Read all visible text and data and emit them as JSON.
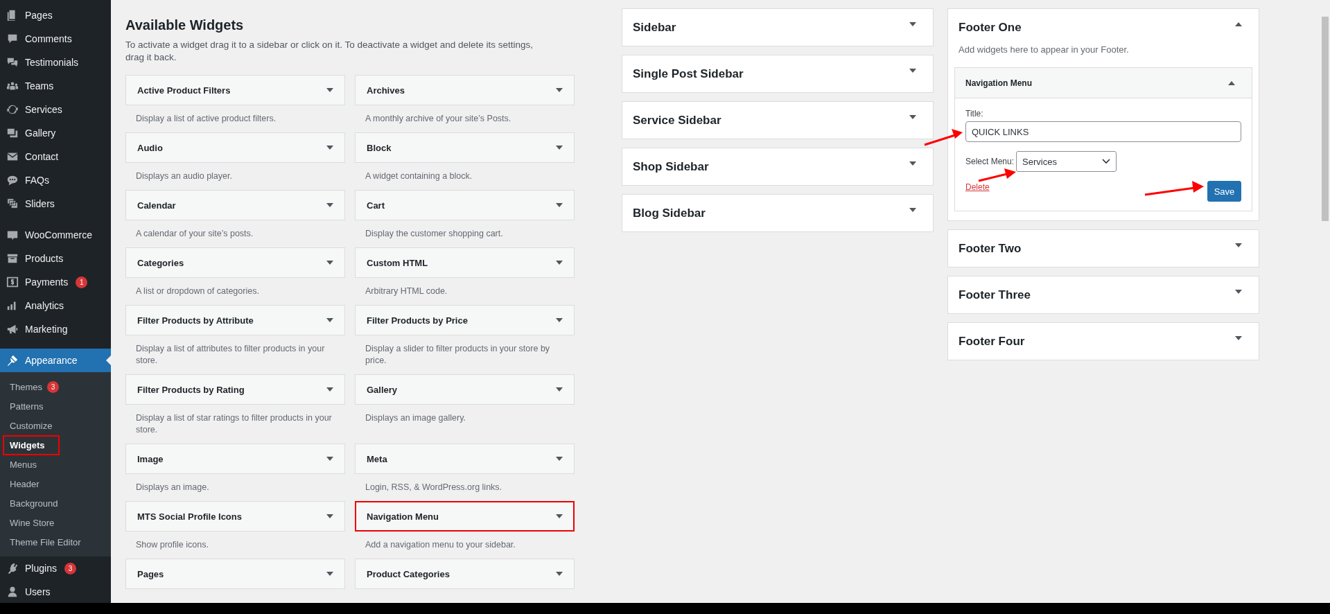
{
  "admin_menu": [
    {
      "items": [
        {
          "label": "Pages",
          "selected": false
        },
        {
          "label": "Comments",
          "selected": false
        },
        {
          "label": "Testimonials",
          "selected": false
        },
        {
          "label": "Teams",
          "selected": false
        },
        {
          "label": "Services",
          "selected": false
        },
        {
          "label": "Gallery",
          "selected": false
        },
        {
          "label": "Contact",
          "selected": false
        },
        {
          "label": "FAQs",
          "selected": false
        },
        {
          "label": "Sliders",
          "selected": false
        }
      ]
    },
    {
      "items": [
        {
          "label": "WooCommerce",
          "selected": false
        },
        {
          "label": "Products",
          "selected": false
        },
        {
          "label": "Payments",
          "selected": false,
          "badge": "1"
        },
        {
          "label": "Analytics",
          "selected": false
        },
        {
          "label": "Marketing",
          "selected": false
        }
      ]
    },
    {
      "items": [
        {
          "label": "Appearance",
          "selected": true,
          "submenu": [
            {
              "label": "Themes",
              "selected": false,
              "highlighted": false,
              "badge": "3"
            },
            {
              "label": "Patterns",
              "selected": false,
              "highlighted": false
            },
            {
              "label": "Customize",
              "selected": false,
              "highlighted": false
            },
            {
              "label": "Widgets",
              "selected": true,
              "highlighted": true
            },
            {
              "label": "Menus",
              "selected": false,
              "highlighted": false
            },
            {
              "label": "Header",
              "selected": false,
              "highlighted": false
            },
            {
              "label": "Background",
              "selected": false,
              "highlighted": false
            },
            {
              "label": "Wine Store",
              "selected": false,
              "highlighted": false
            },
            {
              "label": "Theme File Editor",
              "selected": false,
              "highlighted": false
            }
          ]
        },
        {
          "label": "Plugins",
          "selected": false,
          "badge": "3"
        },
        {
          "label": "Users",
          "selected": false
        }
      ]
    }
  ],
  "available_widgets": {
    "title": "Available Widgets",
    "description": "To activate a widget drag it to a sidebar or click on it. To deactivate a widget and delete its settings, drag it back.",
    "widgets": [
      {
        "title": "Active Product Filters",
        "description": "Display a list of active product filters.",
        "highlighted": false
      },
      {
        "title": "Archives",
        "description": "A monthly archive of your site’s Posts.",
        "highlighted": false
      },
      {
        "title": "Audio",
        "description": "Displays an audio player.",
        "highlighted": false
      },
      {
        "title": "Block",
        "description": "A widget containing a block.",
        "highlighted": false
      },
      {
        "title": "Calendar",
        "description": "A calendar of your site’s posts.",
        "highlighted": false
      },
      {
        "title": "Cart",
        "description": "Display the customer shopping cart.",
        "highlighted": false
      },
      {
        "title": "Categories",
        "description": "A list or dropdown of categories.",
        "highlighted": false
      },
      {
        "title": "Custom HTML",
        "description": "Arbitrary HTML code.",
        "highlighted": false
      },
      {
        "title": "Filter Products by Attribute",
        "description": "Display a list of attributes to filter products in your store.",
        "highlighted": false
      },
      {
        "title": "Filter Products by Price",
        "description": "Display a slider to filter products in your store by price.",
        "highlighted": false
      },
      {
        "title": "Filter Products by Rating",
        "description": "Display a list of star ratings to filter products in your store.",
        "highlighted": false
      },
      {
        "title": "Gallery",
        "description": "Displays an image gallery.",
        "highlighted": false
      },
      {
        "title": "Image",
        "description": "Displays an image.",
        "highlighted": false
      },
      {
        "title": "Meta",
        "description": "Login, RSS, & WordPress.org links.",
        "highlighted": false
      },
      {
        "title": "MTS Social Profile Icons",
        "description": "Show profile icons.",
        "highlighted": false
      },
      {
        "title": "Navigation Menu",
        "description": "Add a navigation menu to your sidebar.",
        "highlighted": true
      },
      {
        "title": "Pages",
        "highlighted": false
      },
      {
        "title": "Product Categories",
        "highlighted": false
      }
    ]
  },
  "widget_areas": [
    {
      "title": "Sidebar",
      "expanded": false
    },
    {
      "title": "Single Post Sidebar",
      "expanded": false
    },
    {
      "title": "Service Sidebar",
      "expanded": false
    },
    {
      "title": "Shop Sidebar",
      "expanded": false
    },
    {
      "title": "Blog Sidebar",
      "expanded": false
    }
  ],
  "footer_areas": [
    {
      "title": "Footer One",
      "expanded": true,
      "description": "Add widgets here to appear in your Footer.",
      "widgets": [
        {
          "title": "Navigation Menu",
          "expanded": true,
          "title_label": "Title:",
          "title_value": "QUICK LINKS",
          "menu_label": "Select Menu:",
          "menu_value": "Services",
          "delete_label": "Delete",
          "save_label": "Save"
        }
      ]
    },
    {
      "title": "Footer Two",
      "expanded": false
    },
    {
      "title": "Footer Three",
      "expanded": false
    },
    {
      "title": "Footer Four",
      "expanded": false
    }
  ],
  "annotation_arrows": [
    {
      "kind": "title"
    },
    {
      "kind": "menu"
    },
    {
      "kind": "save"
    }
  ]
}
